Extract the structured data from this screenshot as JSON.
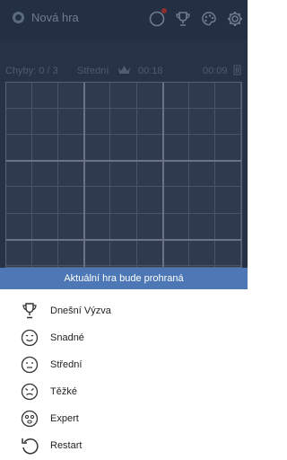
{
  "topbar": {
    "new_game_label": "Nová hra",
    "icons": [
      "new-game-radio-icon",
      "compass-icon",
      "trophy-icon",
      "palette-icon",
      "gear-icon"
    ]
  },
  "status": {
    "errors": "Chyby: 0 / 3",
    "level": "Střední",
    "time_a": "00:18",
    "time_b": "00:09"
  },
  "sheet": {
    "title": "Aktuální hra bude prohraná",
    "items": [
      {
        "label": "Dnešní Výzva",
        "icon": "trophy-icon"
      },
      {
        "label": "Snadné",
        "icon": "easy-face-icon"
      },
      {
        "label": "Střední",
        "icon": "medium-face-icon"
      },
      {
        "label": "Těžké",
        "icon": "hard-face-icon"
      },
      {
        "label": "Expert",
        "icon": "expert-face-icon"
      },
      {
        "label": "Restart",
        "icon": "restart-icon"
      }
    ]
  },
  "colors": {
    "accent": "#4d78b5",
    "overlay_bg": "#233044"
  }
}
